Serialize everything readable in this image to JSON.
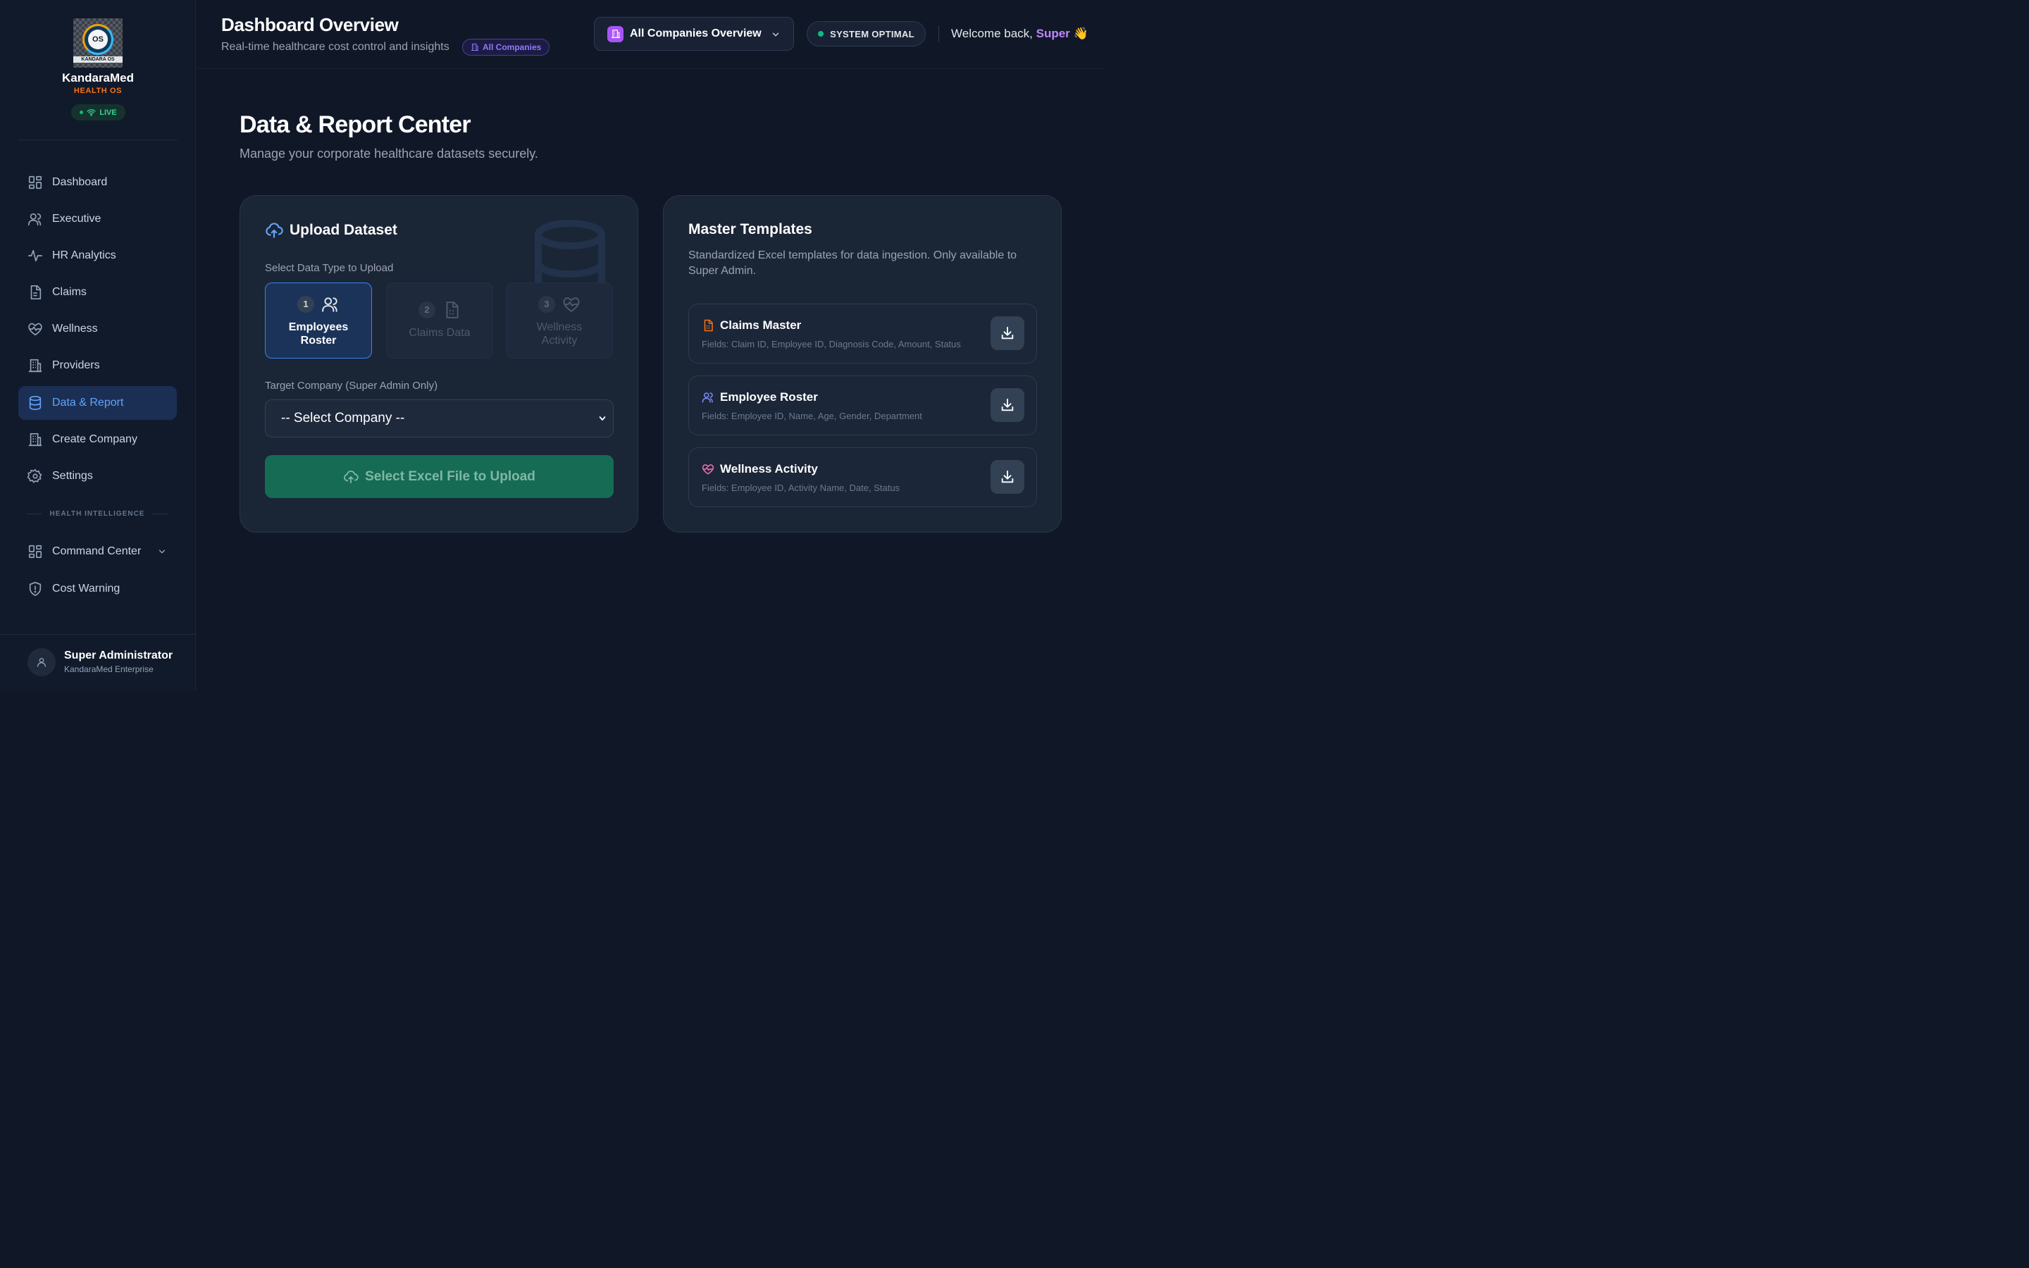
{
  "brand": {
    "logo_text": "OS",
    "logo_caption": "KANDARA OS",
    "name": "KandaraMed",
    "subtitle": "HEALTH OS",
    "live_label": "LIVE"
  },
  "sidebar": {
    "items": [
      {
        "label": "Dashboard",
        "icon": "dashboard-grid-icon"
      },
      {
        "label": "Executive",
        "icon": "users-icon"
      },
      {
        "label": "HR Analytics",
        "icon": "activity-pulse-icon"
      },
      {
        "label": "Claims",
        "icon": "document-icon"
      },
      {
        "label": "Wellness",
        "icon": "heart-pulse-icon"
      },
      {
        "label": "Providers",
        "icon": "building-icon"
      },
      {
        "label": "Data & Report",
        "icon": "database-icon",
        "active": true
      },
      {
        "label": "Create Company",
        "icon": "building-icon"
      },
      {
        "label": "Settings",
        "icon": "gear-icon"
      }
    ],
    "section_label": "HEALTH INTELLIGENCE",
    "intel_items": [
      {
        "label": "Command Center",
        "icon": "dashboard-grid-icon"
      },
      {
        "label": "Cost Warning",
        "icon": "shield-alert-icon"
      }
    ],
    "user": {
      "name": "Super Administrator",
      "org": "KandaraMed Enterprise"
    }
  },
  "header": {
    "title": "Dashboard Overview",
    "subtitle": "Real-time healthcare cost control and insights",
    "badge": "All Companies",
    "company_select": "All Companies Overview",
    "system_status": "SYSTEM OPTIMAL",
    "welcome_prefix": "Welcome back, ",
    "welcome_name": "Super",
    "welcome_emoji": "👋"
  },
  "main": {
    "title": "Data & Report Center",
    "subtitle": "Manage your corporate healthcare datasets securely."
  },
  "upload": {
    "title": "Upload Dataset",
    "type_label": "Select Data Type to Upload",
    "types": [
      {
        "num": "1",
        "line1": "Employees",
        "line2": "Roster",
        "icon": "users-icon"
      },
      {
        "num": "2",
        "line1": "Claims Data",
        "line2": "",
        "icon": "document-icon"
      },
      {
        "num": "3",
        "line1": "Wellness",
        "line2": "Activity",
        "icon": "heart-pulse-icon"
      }
    ],
    "company_label": "Target Company (Super Admin Only)",
    "company_placeholder": "-- Select Company --",
    "button_label": "Select Excel File to Upload"
  },
  "templates": {
    "title": "Master Templates",
    "description": "Standardized Excel templates for data ingestion. Only available to Super Admin.",
    "items": [
      {
        "name": "Claims Master",
        "fields": "Fields: Claim ID, Employee ID, Diagnosis Code, Amount, Status",
        "icon": "document-icon",
        "color": "#f97316"
      },
      {
        "name": "Employee Roster",
        "fields": "Fields: Employee ID, Name, Age, Gender, Department",
        "icon": "users-icon",
        "color": "#818cf8"
      },
      {
        "name": "Wellness Activity",
        "fields": "Fields: Employee ID, Activity Name, Date, Status",
        "icon": "heart-pulse-icon",
        "color": "#f472b6"
      }
    ]
  }
}
